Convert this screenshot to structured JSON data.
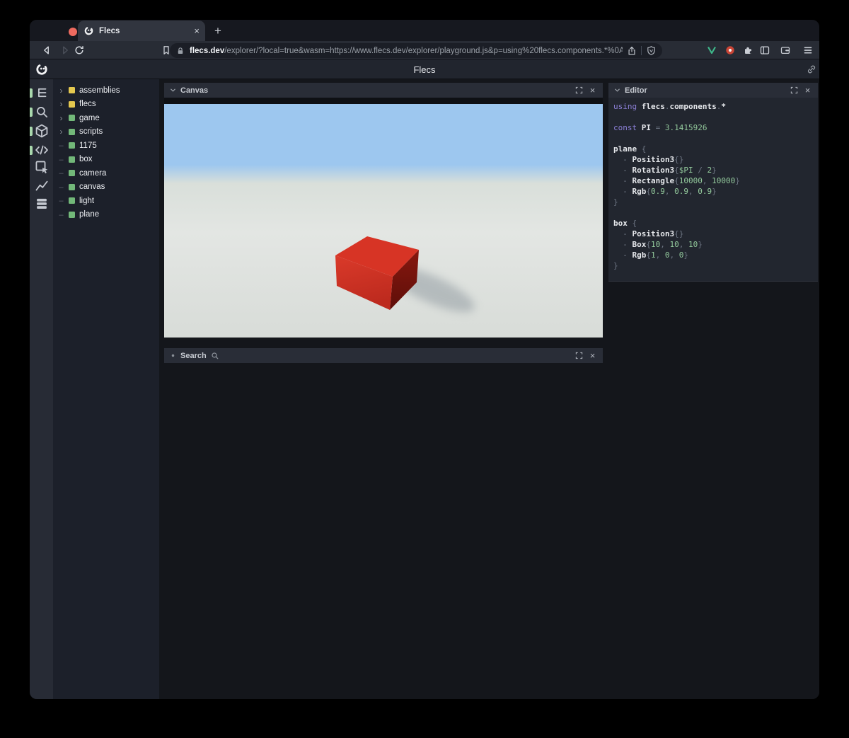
{
  "browser": {
    "tab_title": "Flecs",
    "new_tab_label": "+",
    "tab_close_label": "×",
    "url_domain": "flecs.dev",
    "url_path": "/explorer/?local=true&wasm=https://www.flecs.dev/explorer/playground.js&p=using%20flecs.components.*%0A…",
    "toolbar_icons": [
      "back-icon",
      "forward-icon",
      "reload-icon",
      "bookmark-icon",
      "lock-icon",
      "share-icon",
      "shield-icon",
      "v-extension-icon",
      "record-dot-extension-icon",
      "extensions-puzzle-icon",
      "sidebar-icon",
      "wallet-icon",
      "menu-icon"
    ],
    "traffic_lights": {
      "red": "#ee6a5f",
      "yellow": "#f5bd4f",
      "green": "#61c554"
    }
  },
  "header": {
    "title": "Flecs",
    "logo": "flecs-logo",
    "right_icon": "link-icon"
  },
  "activity_bar": {
    "icons": [
      {
        "name": "outline-tree-icon",
        "active": true
      },
      {
        "name": "search-icon",
        "active": true
      },
      {
        "name": "scene-cube-icon",
        "active": true
      },
      {
        "name": "code-icon",
        "active": true
      },
      {
        "name": "inspector-icon",
        "active": false
      },
      {
        "name": "statistics-chart-icon",
        "active": false
      },
      {
        "name": "storage-stack-icon",
        "active": false
      }
    ],
    "active_indicator_color": "#a9d8ad"
  },
  "tree": {
    "items": [
      {
        "label": "assemblies",
        "toggle": "chevron",
        "color": "yellow"
      },
      {
        "label": "flecs",
        "toggle": "chevron",
        "color": "yellow"
      },
      {
        "label": "game",
        "toggle": "chevron",
        "color": "green"
      },
      {
        "label": "scripts",
        "toggle": "chevron",
        "color": "green"
      },
      {
        "label": "1175",
        "toggle": "dash",
        "color": "green"
      },
      {
        "label": "box",
        "toggle": "dash",
        "color": "green"
      },
      {
        "label": "camera",
        "toggle": "dash",
        "color": "green"
      },
      {
        "label": "canvas",
        "toggle": "dash",
        "color": "green"
      },
      {
        "label": "light",
        "toggle": "dash",
        "color": "green"
      },
      {
        "label": "plane",
        "toggle": "dash",
        "color": "green"
      }
    ]
  },
  "canvas_panel": {
    "title": "Canvas",
    "close_label": "×",
    "scene": {
      "sky_color": "#9dc7ef",
      "ground_color": "#d9ddd9",
      "box_top_color": "#d73425",
      "box_front_color": "#d13023",
      "box_side_color": "#7a150f",
      "shadow_color": "#8d979e"
    }
  },
  "search_panel": {
    "title": "Search",
    "close_label": "×"
  },
  "editor_panel": {
    "title": "Editor",
    "close_label": "×",
    "code_lines": [
      [
        {
          "t": "using ",
          "c": "kw"
        },
        {
          "t": "flecs",
          "c": "id"
        },
        {
          "t": ".",
          "c": "p"
        },
        {
          "t": "components",
          "c": "id"
        },
        {
          "t": ".",
          "c": "p"
        },
        {
          "t": "*",
          "c": "id"
        }
      ],
      [],
      [
        {
          "t": "const ",
          "c": "kw"
        },
        {
          "t": "PI ",
          "c": "id"
        },
        {
          "t": "= ",
          "c": "p"
        },
        {
          "t": "3.1415926",
          "c": "num"
        }
      ],
      [],
      [
        {
          "t": "plane ",
          "c": "id"
        },
        {
          "t": "{",
          "c": "p"
        }
      ],
      [
        {
          "t": "  - ",
          "c": "p"
        },
        {
          "t": "Position3",
          "c": "id"
        },
        {
          "t": "{}",
          "c": "p"
        }
      ],
      [
        {
          "t": "  - ",
          "c": "p"
        },
        {
          "t": "Rotation3",
          "c": "id"
        },
        {
          "t": "{",
          "c": "p"
        },
        {
          "t": "$PI",
          "c": "num"
        },
        {
          "t": " / ",
          "c": "p"
        },
        {
          "t": "2",
          "c": "num"
        },
        {
          "t": "}",
          "c": "p"
        }
      ],
      [
        {
          "t": "  - ",
          "c": "p"
        },
        {
          "t": "Rectangle",
          "c": "id"
        },
        {
          "t": "{",
          "c": "p"
        },
        {
          "t": "10000",
          "c": "num"
        },
        {
          "t": ", ",
          "c": "p"
        },
        {
          "t": "10000",
          "c": "num"
        },
        {
          "t": "}",
          "c": "p"
        }
      ],
      [
        {
          "t": "  - ",
          "c": "p"
        },
        {
          "t": "Rgb",
          "c": "id"
        },
        {
          "t": "{",
          "c": "p"
        },
        {
          "t": "0.9",
          "c": "num"
        },
        {
          "t": ", ",
          "c": "p"
        },
        {
          "t": "0.9",
          "c": "num"
        },
        {
          "t": ", ",
          "c": "p"
        },
        {
          "t": "0.9",
          "c": "num"
        },
        {
          "t": "}",
          "c": "p"
        }
      ],
      [
        {
          "t": "}",
          "c": "p"
        }
      ],
      [],
      [
        {
          "t": "box ",
          "c": "id"
        },
        {
          "t": "{",
          "c": "p"
        }
      ],
      [
        {
          "t": "  - ",
          "c": "p"
        },
        {
          "t": "Position3",
          "c": "id"
        },
        {
          "t": "{}",
          "c": "p"
        }
      ],
      [
        {
          "t": "  - ",
          "c": "p"
        },
        {
          "t": "Box",
          "c": "id"
        },
        {
          "t": "{",
          "c": "p"
        },
        {
          "t": "10",
          "c": "num"
        },
        {
          "t": ", ",
          "c": "p"
        },
        {
          "t": "10",
          "c": "num"
        },
        {
          "t": ", ",
          "c": "p"
        },
        {
          "t": "10",
          "c": "num"
        },
        {
          "t": "}",
          "c": "p"
        }
      ],
      [
        {
          "t": "  - ",
          "c": "p"
        },
        {
          "t": "Rgb",
          "c": "id"
        },
        {
          "t": "{",
          "c": "p"
        },
        {
          "t": "1",
          "c": "num"
        },
        {
          "t": ", ",
          "c": "p"
        },
        {
          "t": "0",
          "c": "num"
        },
        {
          "t": ", ",
          "c": "p"
        },
        {
          "t": "0",
          "c": "num"
        },
        {
          "t": "}",
          "c": "p"
        }
      ],
      [
        {
          "t": "}",
          "c": "p"
        }
      ]
    ]
  }
}
